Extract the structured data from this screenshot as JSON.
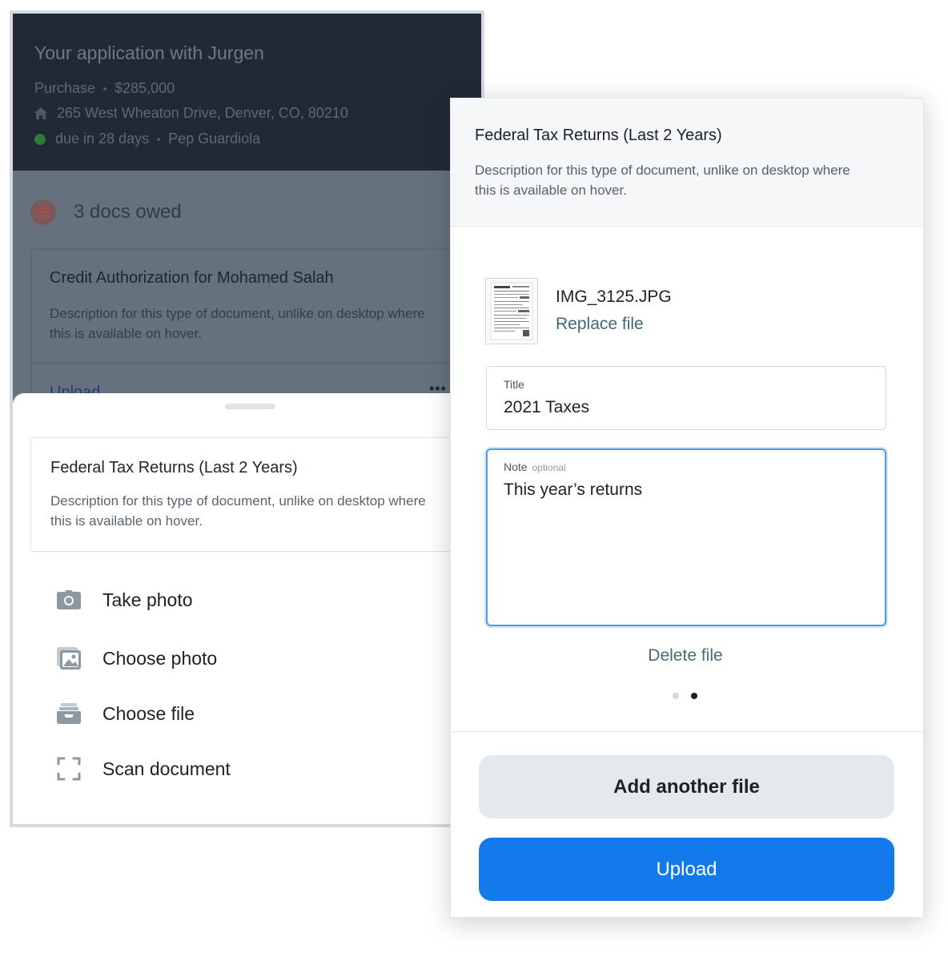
{
  "application": {
    "title": "Your application with Jurgen",
    "purchase_label": "Purchase",
    "purchase_amount": "$285,000",
    "address": "265 West Wheaton Drive, Denver, CO, 80210",
    "due": "due in 28 days",
    "agent": "Pep Guardiola"
  },
  "docs_owed": {
    "label": "3 docs owed"
  },
  "credit_doc": {
    "title": "Credit Authorization for Mohamed Salah",
    "description": "Description for this type of document, unlike on desktop where this is available on hover.",
    "upload_label": "Upload",
    "more_label": "•••"
  },
  "sheet": {
    "doc_title": "Federal Tax Returns (Last 2 Years)",
    "doc_description": "Description for this type of document, unlike on desktop where this is available on hover.",
    "actions": [
      {
        "label": "Take photo",
        "icon": "camera-icon"
      },
      {
        "label": "Choose photo",
        "icon": "image-gallery-icon"
      },
      {
        "label": "Choose file",
        "icon": "file-tray-icon"
      },
      {
        "label": "Scan document",
        "icon": "scan-frame-icon"
      }
    ]
  },
  "upload_screen": {
    "doc_title": "Federal Tax Returns (Last 2 Years)",
    "doc_description": "Description for this type of document, unlike on desktop where this is available on hover.",
    "file_name": "IMG_3125.JPG",
    "replace_label": "Replace file",
    "title_field": {
      "label": "Title",
      "value": "2021 Taxes"
    },
    "note_field": {
      "label": "Note",
      "optional_label": "optional",
      "value": "This year’s returns"
    },
    "delete_label": "Delete file",
    "pager": {
      "total": 2,
      "current": 2
    },
    "add_another_label": "Add another file",
    "upload_label": "Upload"
  },
  "colors": {
    "header_bg": "#212936",
    "overlay": "#66717e",
    "accent_blue": "#1479ea",
    "link_teal": "#3f6877",
    "focus_blue": "#4d9ee6",
    "secondary_button": "#e3e9ed"
  }
}
